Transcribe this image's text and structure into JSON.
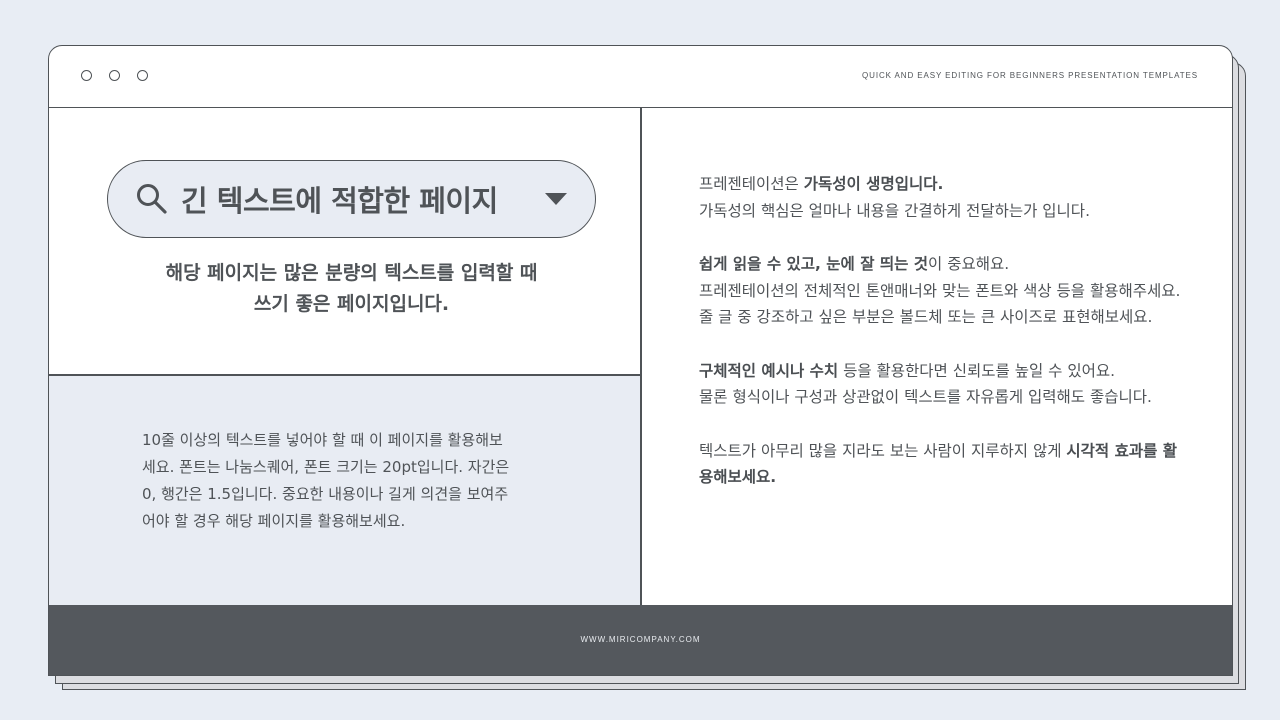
{
  "window": {
    "tagline": "QUICK AND EASY EDITING FOR BEGINNERS PRESENTATION TEMPLATES",
    "footer_url": "WWW.MIRICOMPANY.COM"
  },
  "search": {
    "title": "긴 텍스트에 적합한 페이지",
    "icon": "search-icon",
    "dropdown_icon": "caret-down-icon"
  },
  "subtitle": {
    "line1": "해당 페이지는 많은 분량의 텍스트를 입력할 때",
    "line2": "쓰기 좋은 페이지입니다."
  },
  "left_body": {
    "line1": "10줄 이상의 텍스트를 넣어야 할 때 이 페이지를 활용해보",
    "line2": "세요. 폰트는 나눔스퀘어, 폰트 크기는 20pt입니다. 자간은",
    "line3": "0, 행간은 1.5입니다.  중요한 내용이나 길게 의견을 보여주",
    "line4": "어야 할 경우 해당 페이지를 활용해보세요."
  },
  "right_body": {
    "p1_a": "프레젠테이션은 ",
    "p1_b": "가독성이 생명입니다.",
    "p1_c": "가독성의 핵심은 얼마나 내용을 간결하게 전달하는가 입니다.",
    "p2_a": "쉽게 읽을 수 있고, 눈에 잘 띄는 것",
    "p2_b": "이 중요해요.",
    "p2_c": "프레젠테이션의 전체적인 톤앤매너와 맞는 폰트와 색상 등을 활용해주세요. 줄 글 중 강조하고 싶은 부분은 볼드체 또는 큰 사이즈로 표현해보세요.",
    "p3_a": "구체적인 예시나 수치",
    "p3_b": " 등을 활용한다면 신뢰도를 높일 수 있어요.",
    "p3_c": "물론 형식이나 구성과 상관없이 텍스트를 자유롭게 입력해도 좋습니다.",
    "p4_a": "텍스트가 아무리 많을 지라도 보는 사람이 지루하지 않게 ",
    "p4_b": "시각적 효과를 활용해보세요."
  },
  "colors": {
    "background": "#e8edf4",
    "ink": "#4f5357",
    "panel": "#e8ecf3",
    "footer": "#54585d"
  }
}
